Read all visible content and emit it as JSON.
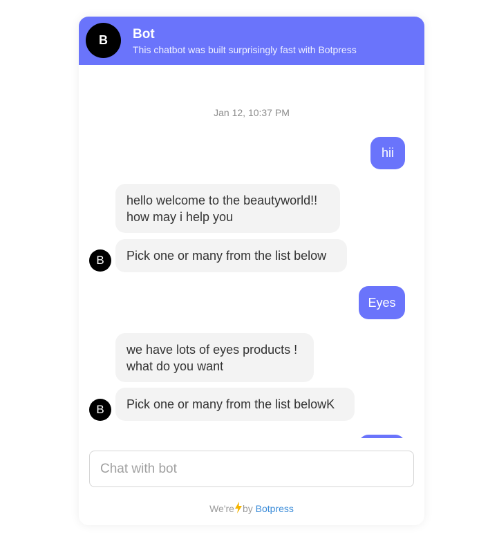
{
  "header": {
    "avatar_initial": "B",
    "bot_name": "Bot",
    "description": "This chatbot was built surprisingly fast with Botpress"
  },
  "conversation": {
    "date": "Jan 12, 10:37 PM",
    "messages": [
      {
        "from": "user",
        "text": "hii"
      },
      {
        "from": "bot",
        "lines": [
          "hello welcome to the beautyworld!!",
          "how may i help you"
        ]
      },
      {
        "from": "bot",
        "text": "Pick one or many from the list below",
        "avatar": "B"
      },
      {
        "from": "user",
        "text": "Eyes"
      },
      {
        "from": "bot",
        "lines": [
          "we have lots of eyes products !",
          "what do you want"
        ]
      },
      {
        "from": "bot",
        "text": "Pick one or many from the list belowK",
        "avatar": "B"
      }
    ]
  },
  "composer": {
    "placeholder": "Chat with bot"
  },
  "footer": {
    "prefix": "We're",
    "icon": "lightning-bolt-icon",
    "by": "by",
    "brand": "Botpress"
  },
  "colors": {
    "accent": "#6a74fb",
    "bot_bubble": "#f3f3f3",
    "brand_link": "#3a8bd8"
  }
}
